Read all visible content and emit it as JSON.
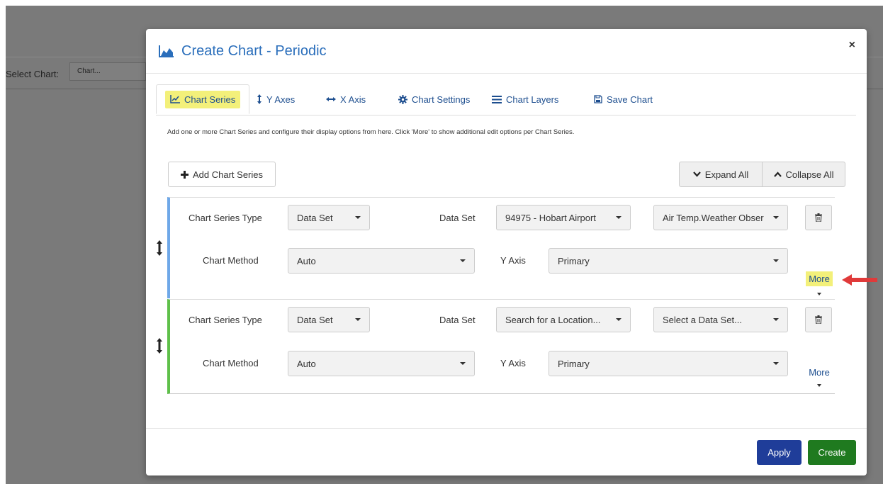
{
  "background": {
    "select_chart_label": "Select Chart:",
    "select_chart_placeholder": "Chart..."
  },
  "modal": {
    "title": "Create Chart - Periodic",
    "close_label": "×",
    "tabs": [
      {
        "label": "Chart Series",
        "icon": "line-chart-icon"
      },
      {
        "label": "Y Axes",
        "icon": "vertical-arrows-icon"
      },
      {
        "label": "X Axis",
        "icon": "horizontal-arrows-icon"
      },
      {
        "label": "Chart Settings",
        "icon": "gear-icon"
      },
      {
        "label": "Chart Layers",
        "icon": "layers-icon"
      },
      {
        "label": "Save Chart",
        "icon": "save-icon"
      }
    ],
    "description": "Add one or more Chart Series and configure their display options from here. Click 'More' to show additional edit options per Chart Series.",
    "add_series_label": "Add Chart Series",
    "expand_all_label": "Expand All",
    "collapse_all_label": "Collapse All",
    "series_labels": {
      "type": "Chart Series Type",
      "data_set": "Data Set",
      "method": "Chart Method",
      "y_axis": "Y Axis",
      "more": "More"
    },
    "series": [
      {
        "type_value": "Data Set",
        "location_value": "94975 - Hobart Airport",
        "dataset_value": "Air Temp.Weather Obser",
        "method_value": "Auto",
        "y_axis_value": "Primary",
        "accent_color": "#6fa8e8"
      },
      {
        "type_value": "Data Set",
        "location_value": "Search for a Location...",
        "dataset_value": "Select a Data Set...",
        "method_value": "Auto",
        "y_axis_value": "Primary",
        "accent_color": "#5fc04a"
      }
    ],
    "apply_label": "Apply",
    "create_label": "Create"
  },
  "colors": {
    "title_blue": "#2a6ebb",
    "highlight": "#f3f07a",
    "apply_bg": "#1f3d99",
    "create_bg": "#1f7a1f",
    "annotation_arrow": "#e03a3a"
  }
}
